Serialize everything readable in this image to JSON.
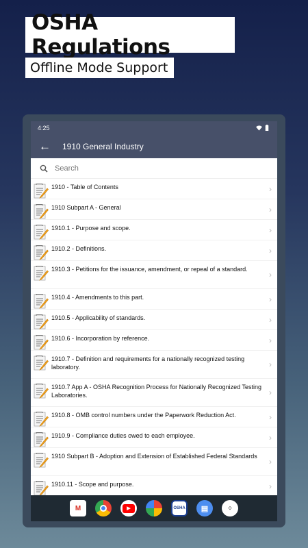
{
  "promo": {
    "title": "OSHA Regulations",
    "subtitle": "Offline Mode Support"
  },
  "status": {
    "time": "4:25"
  },
  "appbar": {
    "title": "1910 General Industry"
  },
  "search": {
    "placeholder": "Search"
  },
  "items": [
    {
      "label": "1910 - Table of Contents"
    },
    {
      "label": "1910 Subpart A - General"
    },
    {
      "label": "1910.1 - Purpose and scope."
    },
    {
      "label": "1910.2 - Definitions."
    },
    {
      "label": "1910.3 - Petitions for the issuance, amendment, or repeal of a standard."
    },
    {
      "label": "1910.4 - Amendments to this part."
    },
    {
      "label": "1910.5 - Applicability of standards."
    },
    {
      "label": "1910.6 - Incorporation by reference."
    },
    {
      "label": "1910.7 - Definition and requirements for a nationally recognized testing laboratory."
    },
    {
      "label": "1910.7 App A - OSHA Recognition Process for Nationally Recognized Testing Laboratories."
    },
    {
      "label": "1910.8 - OMB control numbers under the Paperwork Reduction Act."
    },
    {
      "label": "1910.9 - Compliance duties owed to each employee."
    },
    {
      "label": "1910 Subpart B - Adoption and Extension of Established Federal Standards"
    },
    {
      "label": "1910.11 - Scope and purpose."
    }
  ],
  "dock": [
    "gmail-icon",
    "chrome-icon",
    "youtube-icon",
    "photos-icon",
    "osha-app-icon",
    "messages-icon",
    "app-drawer-icon"
  ],
  "colors": {
    "appbar": "#475069",
    "navbar": "#1f2a33"
  }
}
